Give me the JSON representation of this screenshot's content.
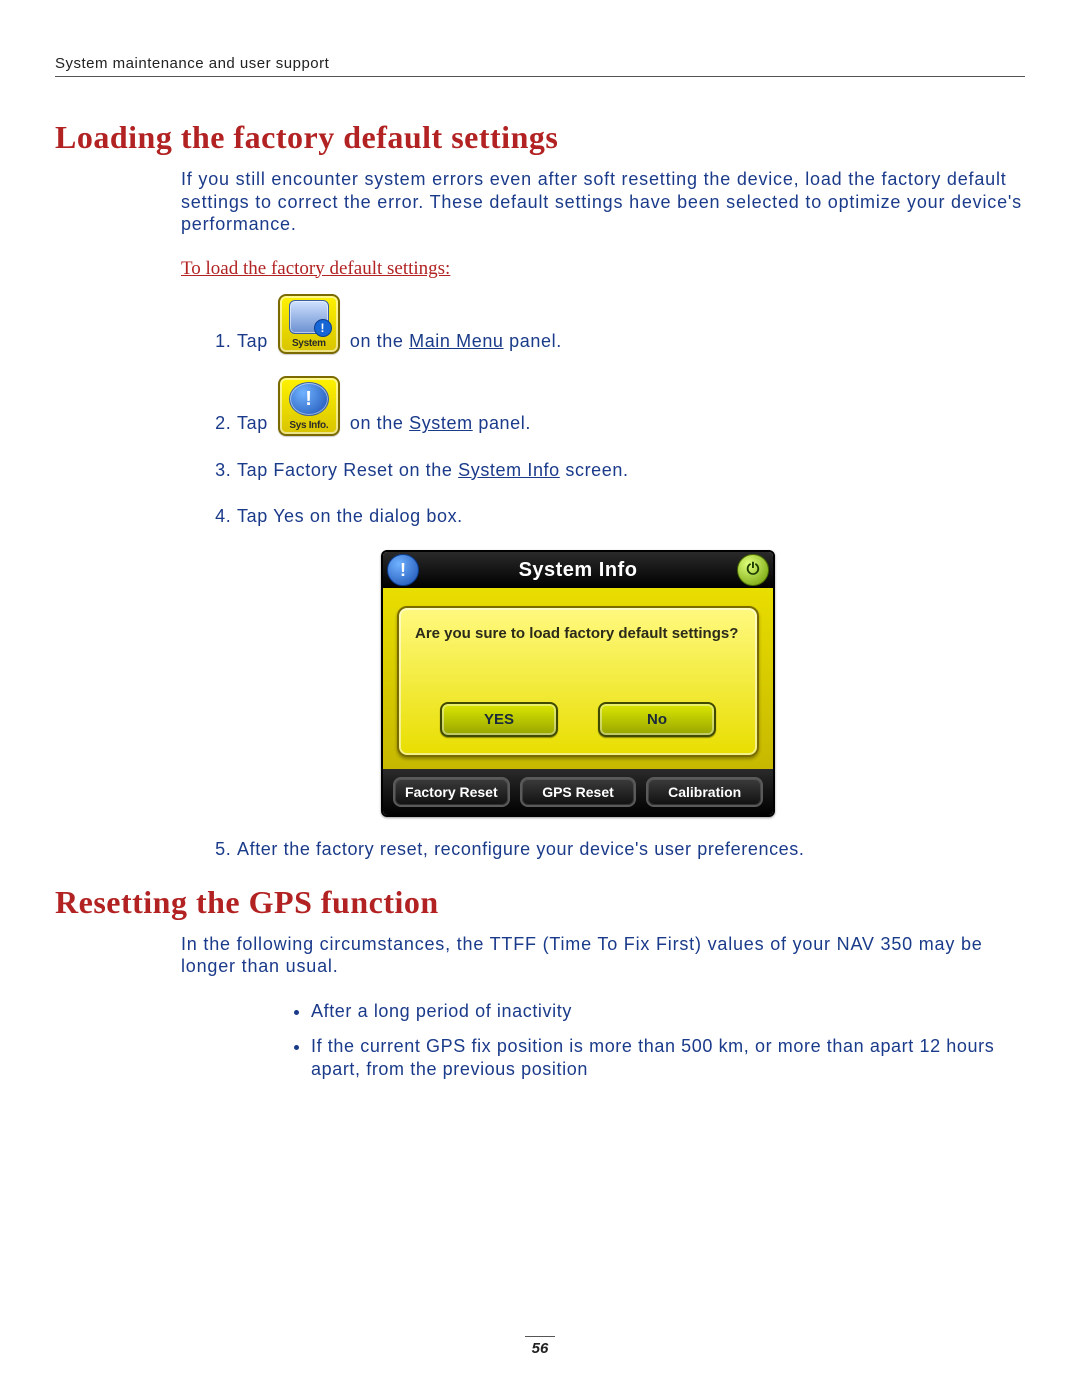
{
  "header": {
    "label": "System maintenance and user support"
  },
  "section1": {
    "title": "Loading the factory default settings",
    "intro": "If you still encounter system errors even after soft resetting the device, load the factory default settings to correct the error. These default settings have been selected to optimize your device's performance.",
    "subhead": "To load the factory default settings:",
    "steps": {
      "s1": {
        "pre": "Tap",
        "icon_label": "System",
        "post1": "on the",
        "link1": "Main Menu",
        "post2": "panel."
      },
      "s2": {
        "pre": "Tap",
        "icon_label": "Sys Info.",
        "post1": "on the",
        "link1": "System",
        "post2": "panel."
      },
      "s3": {
        "pre": "Tap Factory Reset on the",
        "link1": "System Info",
        "post": "screen."
      },
      "s4": {
        "text": "Tap Yes on the dialog box."
      },
      "s5": {
        "text": "After the factory reset, reconfigure your device's user preferences."
      }
    }
  },
  "device": {
    "title": "System Info",
    "left_icon_glyph": "!",
    "right_icon_glyph": "⏻",
    "question": "Are you sure to load factory default settings?",
    "yes": "YES",
    "no": "No",
    "footer": {
      "b1": "Factory Reset",
      "b2": "GPS Reset",
      "b3": "Calibration"
    }
  },
  "section2": {
    "title": "Resetting the GPS function",
    "intro": "In the following circumstances, the TTFF (Time To Fix First) values of your NAV 350 may be longer than usual.",
    "bullets": {
      "b1": "After a long period of inactivity",
      "b2": "If the current GPS fix position is more than 500 km, or more than apart 12 hours apart, from the previous position"
    }
  },
  "page_number": "56"
}
